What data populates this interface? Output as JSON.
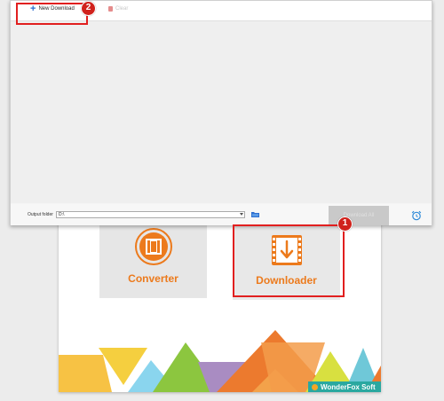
{
  "downloader_window": {
    "toolbar": {
      "new_download_label": "New Download",
      "clear_label": "Clear"
    },
    "output_folder": {
      "label": "Output folder",
      "path_value": "D:\\"
    },
    "download_all_label": "Download All"
  },
  "main_window": {
    "tiles": [
      {
        "label": "Converter",
        "icon": "film-reel-icon"
      },
      {
        "label": "Downloader",
        "icon": "download-arrow-icon"
      }
    ],
    "brand": "WonderFox Soft"
  },
  "annotations": {
    "step_1": "1",
    "step_2": "2"
  },
  "colors": {
    "accent_orange": "#ec7a1c",
    "annotation_red": "#e11f1f",
    "brand_teal": "#2aa8a0",
    "plus_blue": "#2e6fd0"
  }
}
